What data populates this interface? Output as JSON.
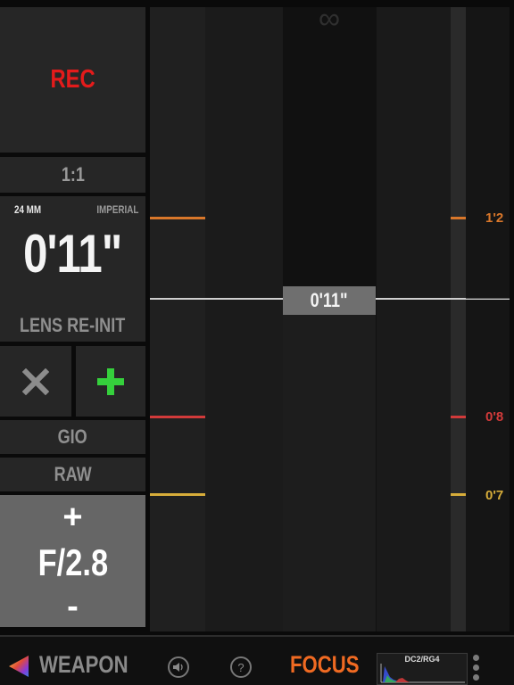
{
  "left_panel": {
    "rec_label": "REC",
    "ratio_label": "1:1",
    "focal_length": "24 MM",
    "units": "IMPERIAL",
    "focus_distance": "0'11\"",
    "lens_reinit_label": "LENS RE-INIT",
    "clear_icon": "x-icon",
    "add_icon": "plus-icon",
    "camera_label": "GIO",
    "format_label": "RAW",
    "iris": {
      "increase": "+",
      "value": "F/2.8",
      "decrease": "-"
    }
  },
  "scale": {
    "infinity_symbol": "∞",
    "current_distance": "0'11\"",
    "marks": [
      {
        "label": "1'2",
        "color": "#d9772a"
      },
      {
        "label": "0'8",
        "color": "#d23a3a"
      },
      {
        "label": "0'7",
        "color": "#d7ad3a"
      }
    ]
  },
  "bottom_bar": {
    "weapon_label": "WEAPON",
    "speaker_icon": "speaker-icon",
    "help_label": "?",
    "focus_label": "FOCUS",
    "histogram_label": "DC2/RG4"
  },
  "colors": {
    "rec": "#e41b1b",
    "add": "#35d03c",
    "focus": "#f06a22"
  }
}
